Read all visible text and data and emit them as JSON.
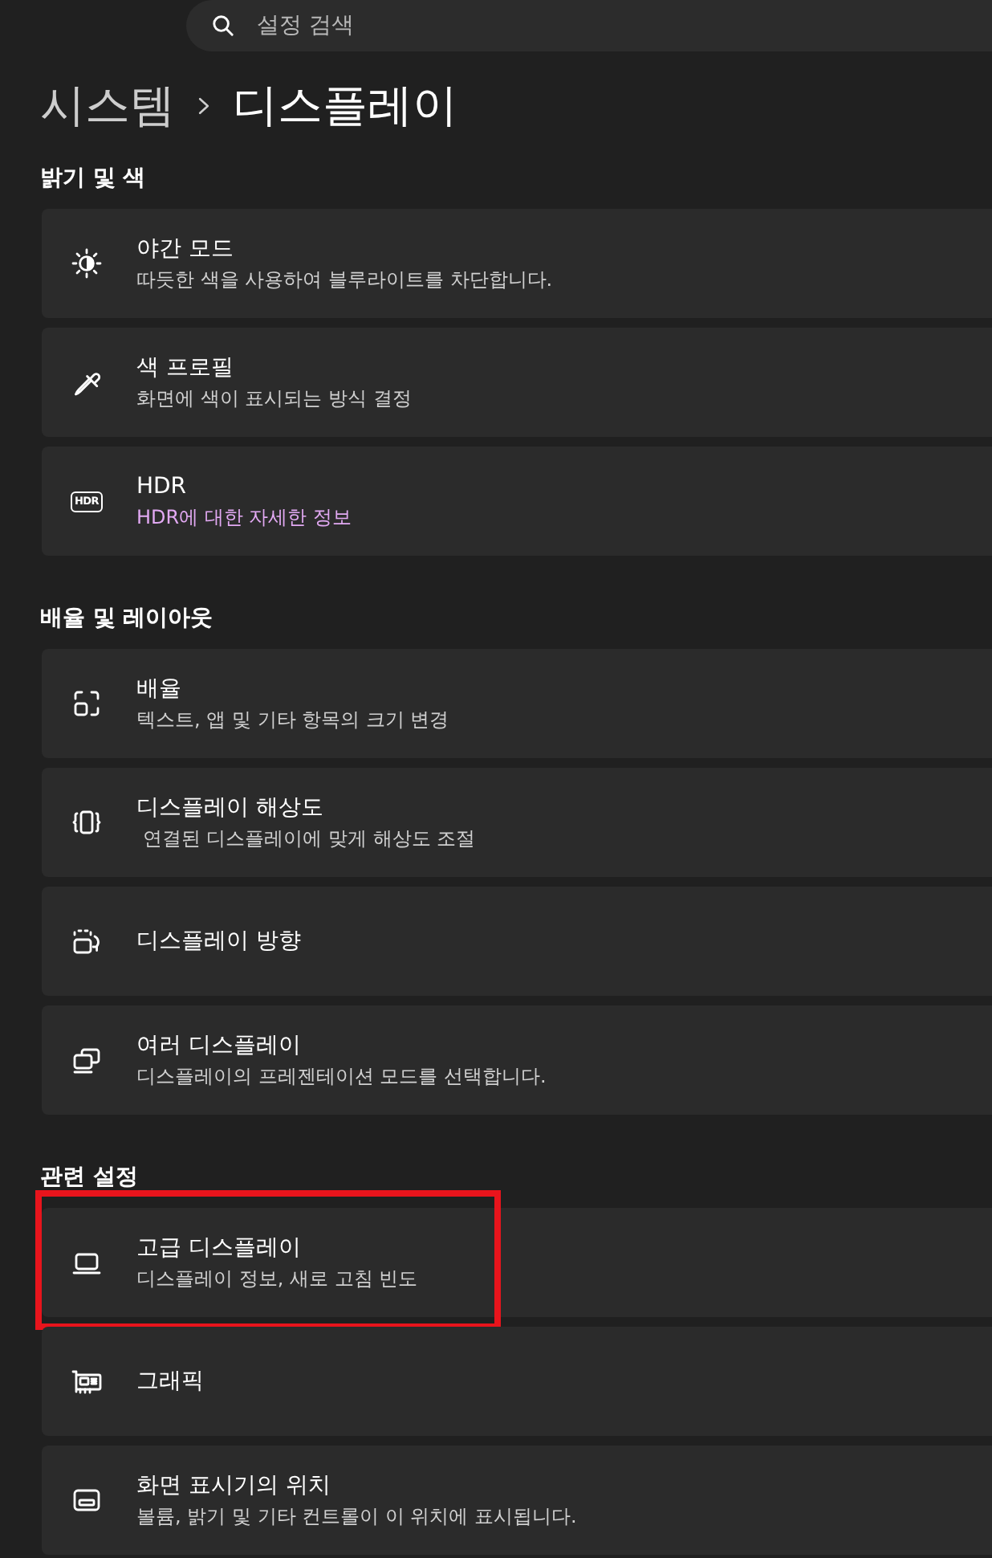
{
  "search": {
    "placeholder": "설정 검색"
  },
  "breadcrumb": [
    {
      "label": "시스템",
      "current": false
    },
    {
      "label": "디스플레이",
      "current": true
    }
  ],
  "sections": [
    {
      "heading": "밝기 및 색",
      "items": [
        {
          "title": "야간 모드",
          "description": "따듯한 색을 사용하여 블루라이트를 차단합니다.",
          "highlighted": false
        },
        {
          "title": "색 프로필",
          "description": "화면에 색이 표시되는 방식 결정",
          "highlighted": false
        },
        {
          "badge": "HDR",
          "title": "HDR",
          "link": "HDR에 대한 자세한 정보",
          "highlighted": false
        }
      ]
    },
    {
      "heading": "배율 및 레이아웃",
      "items": [
        {
          "title": "배율",
          "description": "텍스트, 앱 및 기타 항목의 크기 변경",
          "highlighted": false
        },
        {
          "title": "디스플레이 해상도",
          "description": " 연결된 디스플레이에 맞게 해상도 조절",
          "highlighted": false
        },
        {
          "title": "디스플레이 방향",
          "highlighted": false
        },
        {
          "title": "여러 디스플레이",
          "description": "디스플레이의 프레젠테이션 모드를 선택합니다.",
          "highlighted": false
        }
      ]
    },
    {
      "heading": "관련 설정",
      "items": [
        {
          "title": "고급 디스플레이",
          "description": "디스플레이 정보, 새로 고침 빈도",
          "highlighted": true
        },
        {
          "title": "그래픽",
          "highlighted": false
        },
        {
          "title": "화면 표시기의 위치",
          "description": "볼륨, 밝기 및 기타 컨트롤이 이 위치에 표시됩니다.",
          "highlighted": false
        }
      ]
    }
  ]
}
